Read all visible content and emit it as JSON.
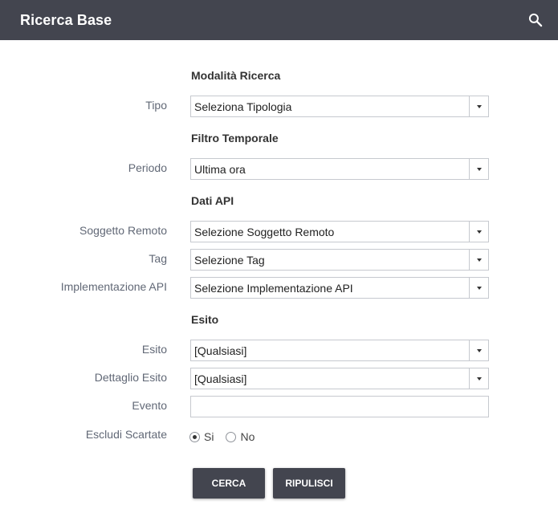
{
  "header": {
    "title": "Ricerca Base",
    "search_icon": "search-icon"
  },
  "colors": {
    "header_bg": "#43454f",
    "button_bg": "#43454f",
    "label": "#616876",
    "border": "#c6c9cf"
  },
  "sections": {
    "modalita": "Modalità Ricerca",
    "filtro": "Filtro Temporale",
    "dati_api": "Dati API",
    "esito": "Esito"
  },
  "fields": {
    "tipo": {
      "label": "Tipo",
      "value": "Seleziona Tipologia"
    },
    "periodo": {
      "label": "Periodo",
      "value": "Ultima ora"
    },
    "soggetto_remoto": {
      "label": "Soggetto Remoto",
      "value": "Selezione Soggetto Remoto"
    },
    "tag": {
      "label": "Tag",
      "value": "Selezione Tag"
    },
    "implementazione_api": {
      "label": "Implementazione API",
      "value": "Selezione Implementazione API"
    },
    "esito": {
      "label": "Esito",
      "value": "[Qualsiasi]"
    },
    "dettaglio_esito": {
      "label": "Dettaglio Esito",
      "value": "[Qualsiasi]"
    },
    "evento": {
      "label": "Evento",
      "value": "",
      "placeholder": ""
    },
    "escludi_scartate": {
      "label": "Escludi Scartate",
      "options": [
        {
          "label": "Si",
          "checked": true
        },
        {
          "label": "No",
          "checked": false
        }
      ]
    }
  },
  "buttons": {
    "cerca": "CERCA",
    "ripulisci": "RIPULISCI"
  }
}
